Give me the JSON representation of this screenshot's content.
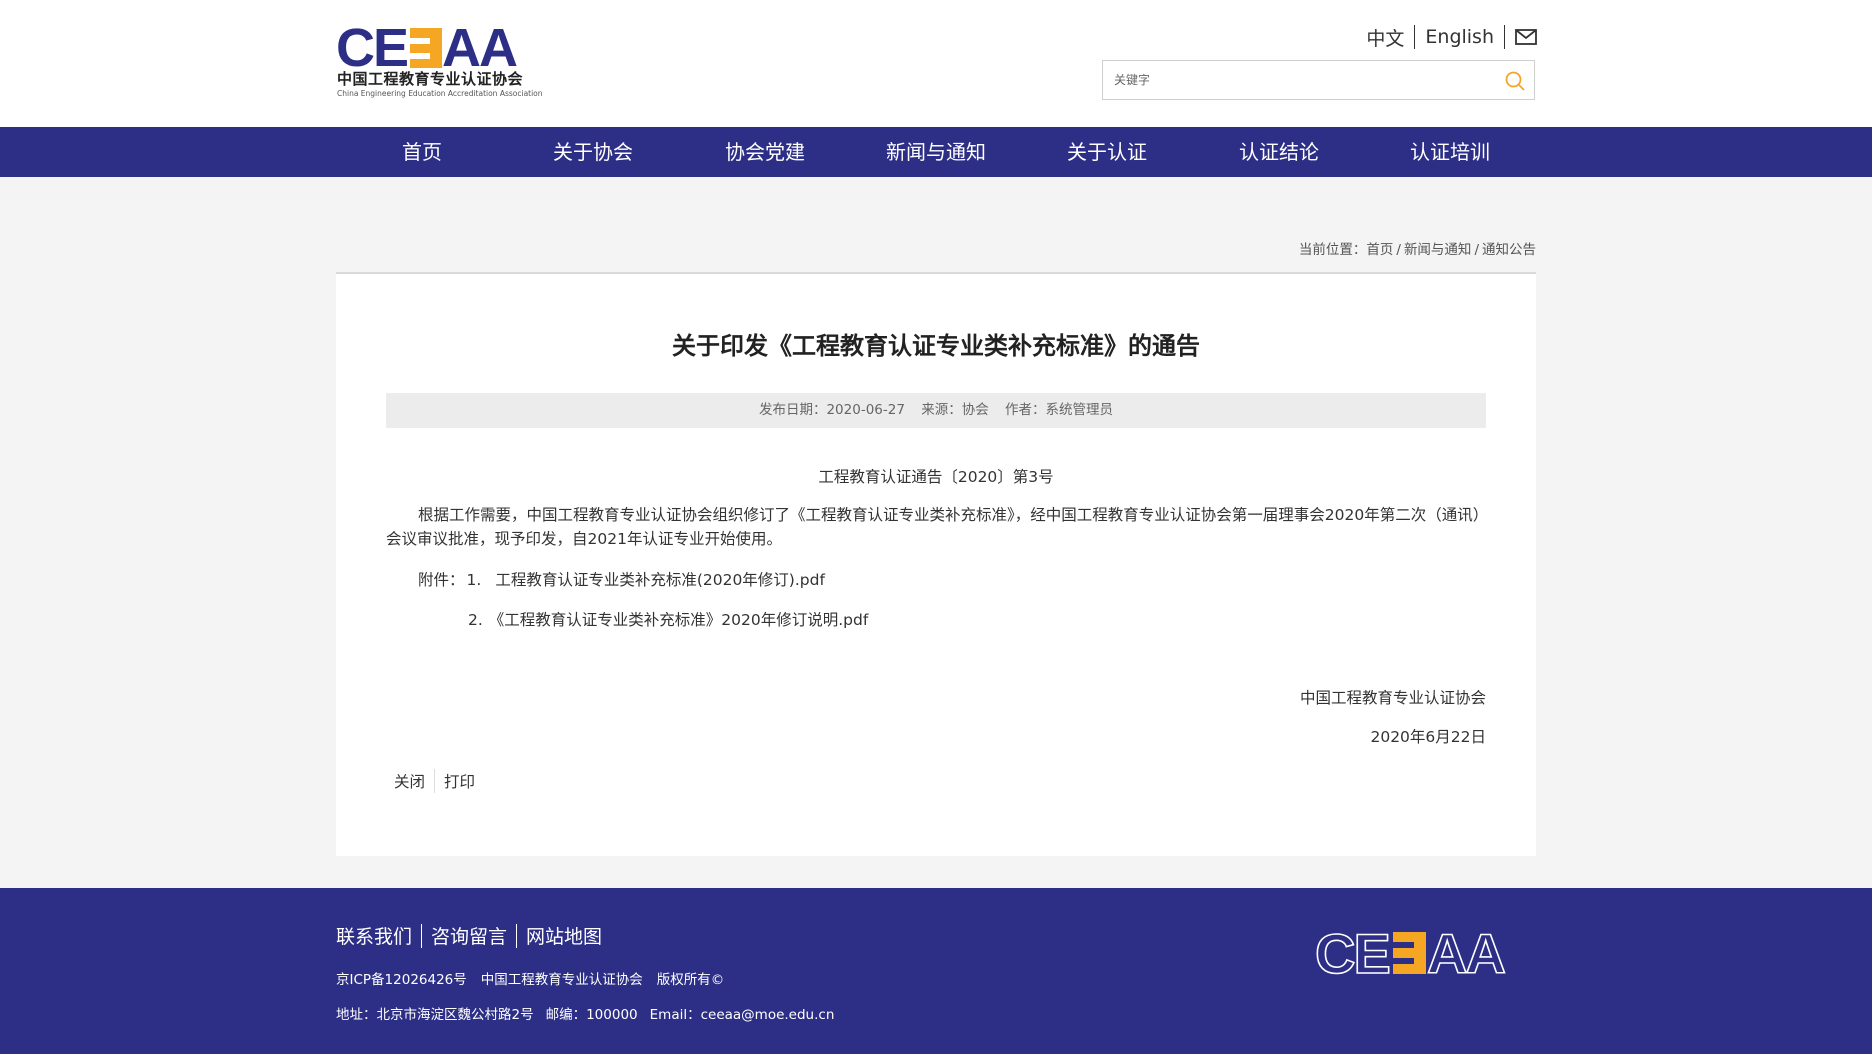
{
  "logo": {
    "letters": "CEEAA",
    "cn_name": "中国工程教育专业认证协会",
    "en_name": "China Engineering Education Accreditation Association"
  },
  "lang": {
    "zh": "中文",
    "en": "English",
    "mail_icon": "mail-icon"
  },
  "search": {
    "placeholder": "关键字",
    "value": "",
    "icon": "search-icon"
  },
  "nav": {
    "items": [
      {
        "label": "首页"
      },
      {
        "label": "关于协会"
      },
      {
        "label": "协会党建"
      },
      {
        "label": "新闻与通知"
      },
      {
        "label": "关于认证"
      },
      {
        "label": "认证结论"
      },
      {
        "label": "认证培训"
      }
    ]
  },
  "breadcrumb": {
    "prefix": "当前位置：",
    "items": [
      "首页",
      "新闻与通知",
      "通知公告"
    ],
    "separator": "/"
  },
  "article": {
    "title": "关于印发《工程教育认证专业类补充标准》的通告",
    "meta": {
      "date_label": "发布日期：",
      "date": "2020-06-27",
      "source_label": "来源：",
      "source": "协会",
      "author_label": "作者：",
      "author": "系统管理员"
    },
    "notice_no": "工程教育认证通告〔2020〕第3号",
    "body": "根据工作需要，中国工程教育专业认证协会组织修订了《工程教育认证专业类补充标准》，经中国工程教育专业认证协会第一届理事会2020年第二次（通讯）会议审议批准，现予印发，自2021年认证专业开始使用。",
    "attachments_label": "附件：",
    "attachments": [
      {
        "num": "1.",
        "name": "工程教育认证专业类补充标准(2020年修订).pdf"
      },
      {
        "num": "2.",
        "name": "《工程教育认证专业类补充标准》2020年修订说明.pdf"
      }
    ],
    "signature_org": "中国工程教育专业认证协会",
    "signature_date": "2020年6月22日"
  },
  "actions": {
    "close": "关闭",
    "print": "打印"
  },
  "footer": {
    "links": [
      "联系我们",
      "咨询留言",
      "网站地图"
    ],
    "icp": "京ICP备12026426号",
    "org": "中国工程教育专业认证协会",
    "copyright": "版权所有©",
    "address": "地址：北京市海淀区魏公村路2号",
    "postcode": "邮编：100000",
    "email": "Email：ceeaa@moe.edu.cn",
    "logo_letters": "CEEAA"
  },
  "colors": {
    "brand_blue": "#2c2f85",
    "brand_orange": "#f5a623",
    "page_bg": "#f4f4f4",
    "meta_bg": "#ececec"
  }
}
